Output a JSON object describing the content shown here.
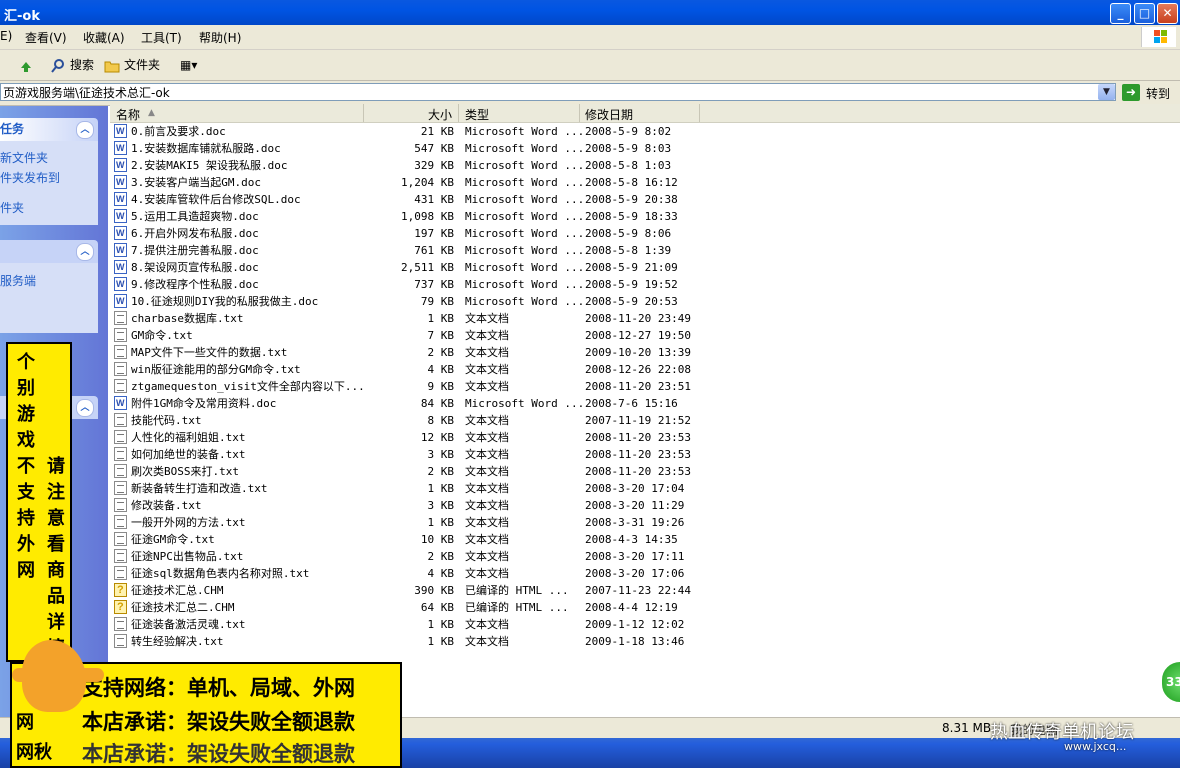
{
  "window": {
    "title": "汇-ok",
    "btn_min": "_",
    "btn_max": "□",
    "btn_close": "✕"
  },
  "menu": {
    "items": [
      "E)",
      "查看(V)",
      "收藏(A)",
      "工具(T)",
      "帮助(H)"
    ]
  },
  "toolbar": {
    "search": "搜索",
    "folders": "文件夹",
    "views_icon": "▦▾"
  },
  "address": {
    "path": "页游戏服务端\\征途技术总汇-ok",
    "go": "转到"
  },
  "left": {
    "tasks_header": "任务",
    "tasks": [
      "新文件夹",
      "件夹发布到",
      "件夹"
    ],
    "other_item": "服务端"
  },
  "columns": {
    "name": "名称",
    "size": "大小",
    "type": "类型",
    "date": "修改日期"
  },
  "files": [
    {
      "name": "0.前言及要求.doc",
      "size": "21 KB",
      "type": "Microsoft Word ...",
      "date": "2008-5-9 8:02",
      "kind": "doc"
    },
    {
      "name": "1.安装数据库铺就私服路.doc",
      "size": "547 KB",
      "type": "Microsoft Word ...",
      "date": "2008-5-9 8:03",
      "kind": "doc"
    },
    {
      "name": "2.安装MAKI5 架设我私服.doc",
      "size": "329 KB",
      "type": "Microsoft Word ...",
      "date": "2008-5-8 1:03",
      "kind": "doc"
    },
    {
      "name": "3.安装客户端当起GM.doc",
      "size": "1,204 KB",
      "type": "Microsoft Word ...",
      "date": "2008-5-8 16:12",
      "kind": "doc"
    },
    {
      "name": "4.安装库管软件后台修改SQL.doc",
      "size": "431 KB",
      "type": "Microsoft Word ...",
      "date": "2008-5-9 20:38",
      "kind": "doc"
    },
    {
      "name": "5.运用工具造超爽物.doc",
      "size": "1,098 KB",
      "type": "Microsoft Word ...",
      "date": "2008-5-9 18:33",
      "kind": "doc"
    },
    {
      "name": "6.开启外网发布私服.doc",
      "size": "197 KB",
      "type": "Microsoft Word ...",
      "date": "2008-5-9 8:06",
      "kind": "doc"
    },
    {
      "name": "7.提供注册完善私服.doc",
      "size": "761 KB",
      "type": "Microsoft Word ...",
      "date": "2008-5-8 1:39",
      "kind": "doc"
    },
    {
      "name": "8.架设网页宣传私服.doc",
      "size": "2,511 KB",
      "type": "Microsoft Word ...",
      "date": "2008-5-9 21:09",
      "kind": "doc"
    },
    {
      "name": "9.修改程序个性私服.doc",
      "size": "737 KB",
      "type": "Microsoft Word ...",
      "date": "2008-5-9 19:52",
      "kind": "doc"
    },
    {
      "name": "10.征途规则DIY我的私服我做主.doc",
      "size": "79 KB",
      "type": "Microsoft Word ...",
      "date": "2008-5-9 20:53",
      "kind": "doc"
    },
    {
      "name": "charbase数据库.txt",
      "size": "1 KB",
      "type": "文本文档",
      "date": "2008-11-20 23:49",
      "kind": "txt"
    },
    {
      "name": "GM命令.txt",
      "size": "7 KB",
      "type": "文本文档",
      "date": "2008-12-27 19:50",
      "kind": "txt"
    },
    {
      "name": "MAP文件下一些文件的数据.txt",
      "size": "2 KB",
      "type": "文本文档",
      "date": "2009-10-20 13:39",
      "kind": "txt"
    },
    {
      "name": "win版征途能用的部分GM命令.txt",
      "size": "4 KB",
      "type": "文本文档",
      "date": "2008-12-26 22:08",
      "kind": "txt"
    },
    {
      "name": "ztgamequeston_visit文件全部内容以下...",
      "size": "9 KB",
      "type": "文本文档",
      "date": "2008-11-20 23:51",
      "kind": "txt"
    },
    {
      "name": "附件1GM命令及常用资料.doc",
      "size": "84 KB",
      "type": "Microsoft Word ...",
      "date": "2008-7-6 15:16",
      "kind": "doc"
    },
    {
      "name": "技能代码.txt",
      "size": "8 KB",
      "type": "文本文档",
      "date": "2007-11-19 21:52",
      "kind": "txt"
    },
    {
      "name": "人性化的福利姐姐.txt",
      "size": "12 KB",
      "type": "文本文档",
      "date": "2008-11-20 23:53",
      "kind": "txt"
    },
    {
      "name": "如何加绝世的装备.txt",
      "size": "3 KB",
      "type": "文本文档",
      "date": "2008-11-20 23:53",
      "kind": "txt"
    },
    {
      "name": "刷次类BOSS来打.txt",
      "size": "2 KB",
      "type": "文本文档",
      "date": "2008-11-20 23:53",
      "kind": "txt"
    },
    {
      "name": "新装备转生打造和改造.txt",
      "size": "1 KB",
      "type": "文本文档",
      "date": "2008-3-20 17:04",
      "kind": "txt"
    },
    {
      "name": "修改装备.txt",
      "size": "3 KB",
      "type": "文本文档",
      "date": "2008-3-20 11:29",
      "kind": "txt"
    },
    {
      "name": "一般开外网的方法.txt",
      "size": "1 KB",
      "type": "文本文档",
      "date": "2008-3-31 19:26",
      "kind": "txt"
    },
    {
      "name": "征途GM命令.txt",
      "size": "10 KB",
      "type": "文本文档",
      "date": "2008-4-3 14:35",
      "kind": "txt"
    },
    {
      "name": "征途NPC出售物品.txt",
      "size": "2 KB",
      "type": "文本文档",
      "date": "2008-3-20 17:11",
      "kind": "txt"
    },
    {
      "name": "征途sql数据角色表内名称对照.txt",
      "size": "4 KB",
      "type": "文本文档",
      "date": "2008-3-20 17:06",
      "kind": "txt"
    },
    {
      "name": "征途技术汇总.CHM",
      "size": "390 KB",
      "type": "已编译的 HTML ...",
      "date": "2007-11-23 22:44",
      "kind": "chm"
    },
    {
      "name": "征途技术汇总二.CHM",
      "size": "64 KB",
      "type": "已编译的 HTML ...",
      "date": "2008-4-4 12:19",
      "kind": "chm"
    },
    {
      "name": "征途装备激活灵魂.txt",
      "size": "1 KB",
      "type": "文本文档",
      "date": "2009-1-12 12:02",
      "kind": "txt"
    },
    {
      "name": "转生经验解决.txt",
      "size": "1 KB",
      "type": "文本文档",
      "date": "2009-1-18 13:46",
      "kind": "txt"
    }
  ],
  "status": {
    "size": "8.31 MB",
    "location": "我的电脑"
  },
  "banner": {
    "col1": "个别游戏不支持外网",
    "col2": "请注意看商品详情",
    "line1": "支持网络：单机、局域、外网",
    "line2": "本店承诺：架设失败全额退款",
    "line3": "本店承诺：架设失败全额退款",
    "frag1": "网",
    "frag2": "网秋"
  },
  "watermark": {
    "main": "热血传奇单机论坛",
    "sub": "www.jxcq..."
  },
  "badge": {
    "text": "33"
  },
  "colors": {
    "xp_blue": "#0054e3",
    "banner_yellow": "#ffeb00",
    "link_blue": "#215dc6"
  }
}
